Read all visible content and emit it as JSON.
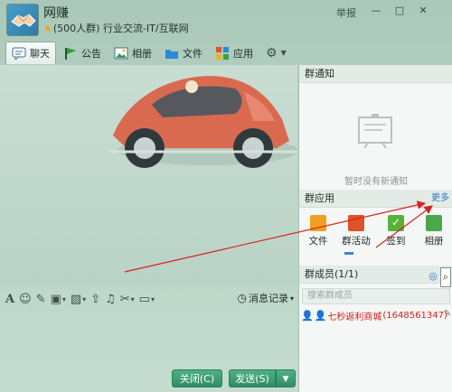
{
  "title": {
    "group_name": "网赚",
    "group_desc": "(500人群) 行业交流-IT/互联网",
    "report": "举报",
    "btn_min": "—",
    "btn_max": "□",
    "btn_close": "✕"
  },
  "tabs": [
    {
      "label": "聊天",
      "icon": "chat-icon"
    },
    {
      "label": "公告",
      "icon": "flag-icon"
    },
    {
      "label": "相册",
      "icon": "picture-icon"
    },
    {
      "label": "文件",
      "icon": "folder-icon"
    },
    {
      "label": "应用",
      "icon": "apps-icon"
    }
  ],
  "toolbar": {
    "message_record": "消息记录"
  },
  "buttons": {
    "close": "关闭(C)",
    "send": "发送(S)"
  },
  "right_panel": {
    "notice_title": "群通知",
    "notice_empty": "暂时没有新通知",
    "apps_title": "群应用",
    "more": "更多",
    "apps": [
      {
        "label": "文件",
        "color": "#f0a020"
      },
      {
        "label": "群活动",
        "color": "#e0532a"
      },
      {
        "label": "签到",
        "color": "#58b23a"
      },
      {
        "label": "相册",
        "color": "#4ea64a"
      }
    ],
    "members_title": "群成员(1/1)",
    "search_placeholder": "搜索群成员",
    "member": {
      "name": "七秒返利商城",
      "id": "(1648561347)"
    }
  },
  "colors": {
    "accent_green": "#2f8d64",
    "link_blue": "#2f76c6",
    "member_red": "#d4201a",
    "annotation_red": "#d9221c"
  }
}
